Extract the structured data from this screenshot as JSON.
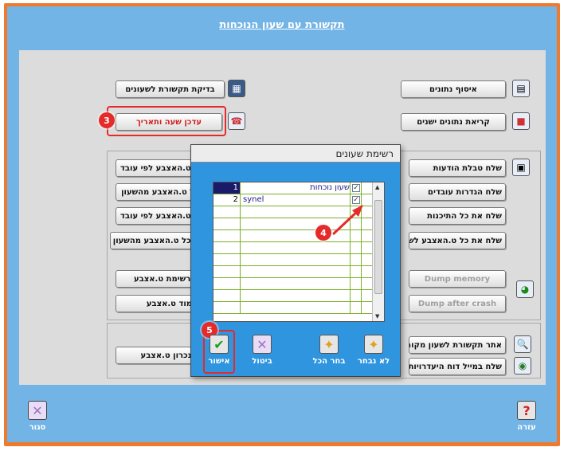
{
  "window": {
    "title": "תקשורת עם שעון הנוכחות"
  },
  "left_buttons": {
    "check_comm": "בדיקת תקשורת לשעונים",
    "update_time": "עדכן שעה ותאריך",
    "send_fp_by_worker": "ת ט.האצבע לפי עובד",
    "send_all_fp_from_clock": "כל ט.האצבע מהשעון",
    "send_fp_by_worker_2": "ת ט.האצבע  לפי עובד",
    "send_all_fp_clock_2": "ת כל ט.האצבע מהשעון",
    "fp_list": "א  רשימת ט.אצבע",
    "learn_fp": "לימוד ט.אצבע",
    "sync_fp": "סינכרון ט.אצבע"
  },
  "right_buttons": {
    "collect_data": "איסוף נתונים",
    "read_old_data": "קריאת נתונים ישנים",
    "send_msg_table": "שלח טבלת הודעות",
    "send_worker_settings": "שלח הגדרות עובדים",
    "send_all_settings": "שלח את כל התיכנות",
    "send_all_fp_to_clock": "שלח את כל ט.האצבע לשעו",
    "dump_memory": "Dump memory",
    "dump_after_crash": "Dump after crash",
    "find_local_clock": "אתר תקשורת לשעון מקומי",
    "send_attendance_report": "שלח במייל דוח היעדרויות יו"
  },
  "modal": {
    "title": "רשימת שעונים",
    "rows": [
      {
        "num": "1",
        "name": "שעון נוכחות",
        "checked": "✓"
      },
      {
        "num": "2",
        "name": "synel",
        "checked": "✓"
      }
    ],
    "buttons": {
      "confirm": "אישור",
      "cancel": "ביטול",
      "select_all": "בחר הכל",
      "deselect": "לא נבחר"
    }
  },
  "badges": {
    "b3": "3",
    "b4": "4",
    "b5": "5"
  },
  "footer": {
    "close": "סגור",
    "help": "עזרה",
    "help_glyph": "?"
  },
  "colors": {
    "frame": "#ef7a2c",
    "window": "#72b4e6",
    "modal": "#2f95df",
    "highlight": "#e52a2a"
  }
}
